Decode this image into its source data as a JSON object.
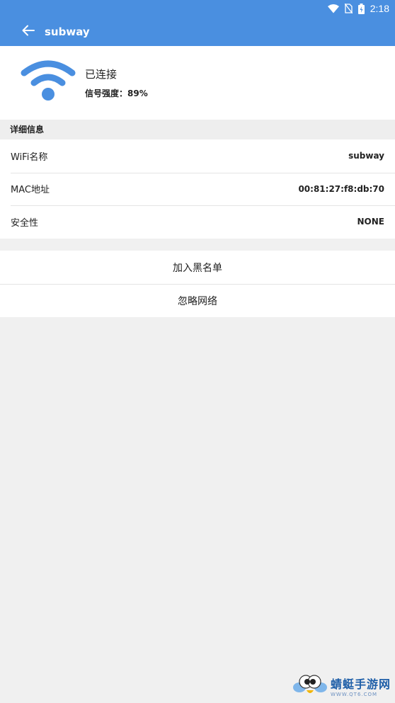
{
  "statusbar": {
    "time": "2:18",
    "icons": [
      "wifi-icon",
      "no-sim-icon",
      "battery-charging-icon"
    ]
  },
  "appbar": {
    "title": "subway",
    "back_icon": "arrow-left-icon"
  },
  "hero": {
    "status": "已连接",
    "signal": "信号强度：89%"
  },
  "details": {
    "header": "详细信息",
    "rows": [
      {
        "label": "WiFi名称",
        "value": "subway"
      },
      {
        "label": "MAC地址",
        "value": "00:81:27:f8:db:70"
      },
      {
        "label": "安全性",
        "value": "NONE"
      }
    ]
  },
  "actions": [
    {
      "label": "加入黑名单"
    },
    {
      "label": "忽略网络"
    }
  ],
  "watermark": {
    "title": "蜻蜓手游网",
    "url": "WWW.QT6.COM"
  },
  "colors": {
    "primary": "#4a8fe0",
    "background": "#f0f0f0"
  }
}
